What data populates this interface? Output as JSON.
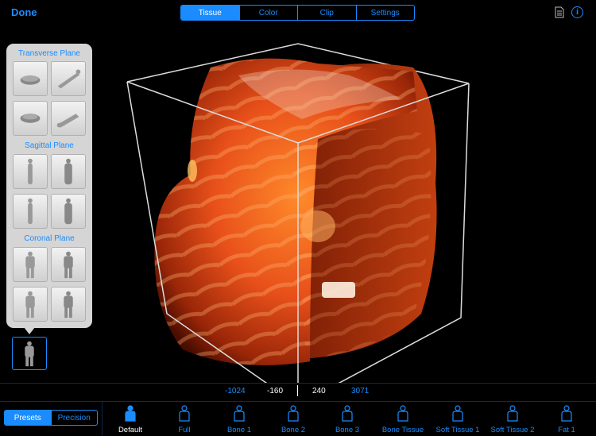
{
  "header": {
    "done_label": "Done",
    "tabs": [
      {
        "label": "Tissue",
        "active": true
      },
      {
        "label": "Color",
        "active": false
      },
      {
        "label": "Clip",
        "active": false
      },
      {
        "label": "Settings",
        "active": false
      }
    ],
    "icons": [
      "document-icon",
      "info-icon"
    ]
  },
  "orientation_panel": {
    "sections": [
      "Transverse Plane",
      "Sagittal Plane",
      "Coronal Plane"
    ]
  },
  "range": {
    "values": [
      "-1024",
      "-160",
      "240",
      "3071"
    ]
  },
  "mode_toggle": {
    "options": [
      {
        "label": "Presets",
        "active": true
      },
      {
        "label": "Precision",
        "active": false
      }
    ]
  },
  "presets": [
    {
      "label": "Default",
      "active": true
    },
    {
      "label": "Full",
      "active": false
    },
    {
      "label": "Bone 1",
      "active": false
    },
    {
      "label": "Bone 2",
      "active": false
    },
    {
      "label": "Bone 3",
      "active": false
    },
    {
      "label": "Bone Tissue",
      "active": false
    },
    {
      "label": "Soft Tissue 1",
      "active": false
    },
    {
      "label": "Soft Tissue 2",
      "active": false
    },
    {
      "label": "Fat 1",
      "active": false
    }
  ],
  "colors": {
    "accent": "#1a8cff",
    "panel": "#d5d5d5",
    "background": "#000000"
  }
}
